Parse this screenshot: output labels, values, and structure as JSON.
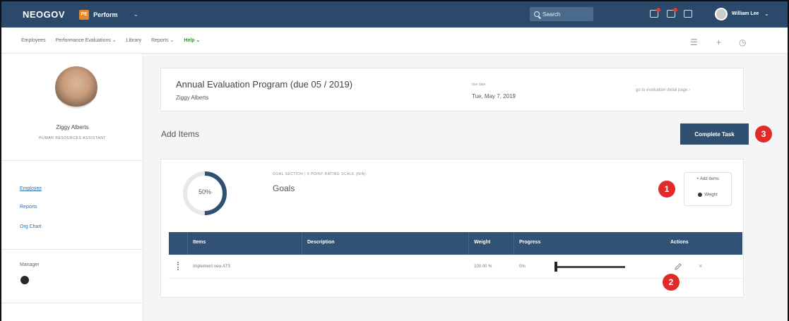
{
  "topbar": {
    "logo": "NEOGOV",
    "product_badge": "PE",
    "product_name": "Perform",
    "product_chevron": "⌄",
    "search_placeholder": "Search",
    "user_name": "William Lee",
    "user_chevron": "⌄"
  },
  "nav": {
    "items": [
      "Employees",
      "Performance Evaluations ⌄",
      "Library",
      "Reports ⌄",
      "Help ⌄"
    ],
    "active_index": 4
  },
  "sidebar": {
    "name": "Ziggy Alberts",
    "role": "HUMAN RESOURCES ASSISTANT",
    "links": [
      "Employee",
      "Reports",
      "Org Chart"
    ],
    "manager_label": "Manager"
  },
  "program": {
    "title": "Annual Evaluation Program (due 05 / 2019)",
    "subject": "Ziggy Alberts",
    "date_label": "due date",
    "date": "Tue, May 7, 2019",
    "link": "go to evaluation detail page ›"
  },
  "add_items": {
    "title": "Add Items",
    "complete_button": "Complete Task"
  },
  "goal_section": {
    "percent_label": "50%",
    "percent_value": 0.5,
    "meta": "GOAL SECTION | 5 POINT RATING SCALE (N/A)",
    "title": "Goals",
    "add_items_button": "+ Add Items",
    "weight_button": "Weight"
  },
  "table": {
    "headers": [
      "Items",
      "Description",
      "Weight",
      "Progress",
      "Actions"
    ],
    "rows": [
      {
        "item": "Implement new ATS",
        "description": "",
        "weight": "100.00 %",
        "progress": "0%",
        "progress_value": 0
      }
    ]
  },
  "callouts": [
    "1",
    "2",
    "3"
  ],
  "colors": {
    "topbar": "#2b4a6b",
    "primary_button": "#2f5070",
    "table_header": "#315275",
    "callout": "#e12a2a",
    "nav_active": "#3a8a3a"
  }
}
